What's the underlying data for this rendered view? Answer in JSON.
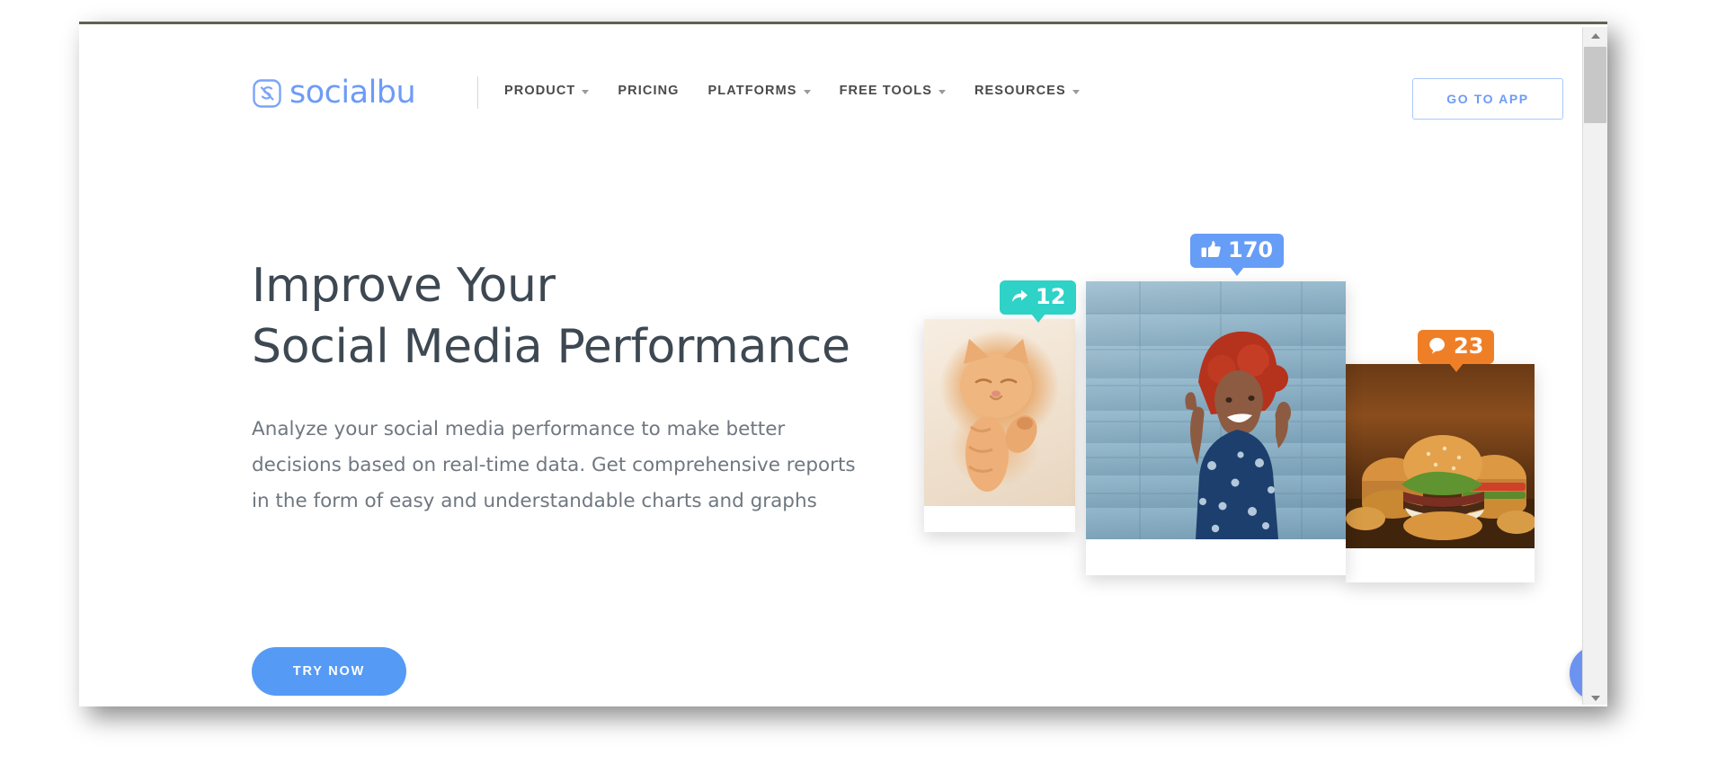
{
  "browser": {
    "scrollbar": {
      "up_arrow_icon": "triangle-up-icon",
      "down_arrow_icon": "triangle-down-icon"
    }
  },
  "header": {
    "logo": {
      "icon": "socialbu-logo-icon",
      "text": "socialbu"
    },
    "nav_items": [
      {
        "label": "PRODUCT",
        "has_caret": true
      },
      {
        "label": "PRICING",
        "has_caret": false
      },
      {
        "label": "PLATFORMS",
        "has_caret": true
      },
      {
        "label": "FREE TOOLS",
        "has_caret": true
      },
      {
        "label": "RESOURCES",
        "has_caret": true
      }
    ],
    "cta": {
      "label": "GO TO APP"
    }
  },
  "hero": {
    "title_line_1": "Improve Your",
    "title_line_2": "Social Media Performance",
    "subtitle": "Analyze your social media performance to make better decisions based on real-time data. Get comprehensive reports in the form of easy and understandable charts and graphs",
    "cta": {
      "label": "TRY NOW"
    },
    "collage": {
      "cards": [
        {
          "name": "cat-photo-card",
          "alt": "sleeping orange kitten"
        },
        {
          "name": "woman-photo-card",
          "alt": "smiling woman pointing in front of blue wall"
        },
        {
          "name": "burgers-photo-card",
          "alt": "burgers on wooden board"
        }
      ],
      "badges": [
        {
          "type": "share",
          "icon": "share-arrow-icon",
          "value": "12",
          "color": "#2ed2c6"
        },
        {
          "type": "like",
          "icon": "thumbs-up-icon",
          "value": "170",
          "color": "#669df6"
        },
        {
          "type": "comment",
          "icon": "speech-bubble-icon",
          "value": "23",
          "color": "#ef7f27"
        }
      ]
    }
  },
  "support": {
    "chat_button": {
      "icon": "chat-bubble-icon",
      "color": "#6d93f0"
    }
  },
  "colors": {
    "brand_blue": "#6d9bf7",
    "cta_blue": "#559bf5",
    "heading": "#3d4852",
    "body_text": "#6f7780"
  }
}
